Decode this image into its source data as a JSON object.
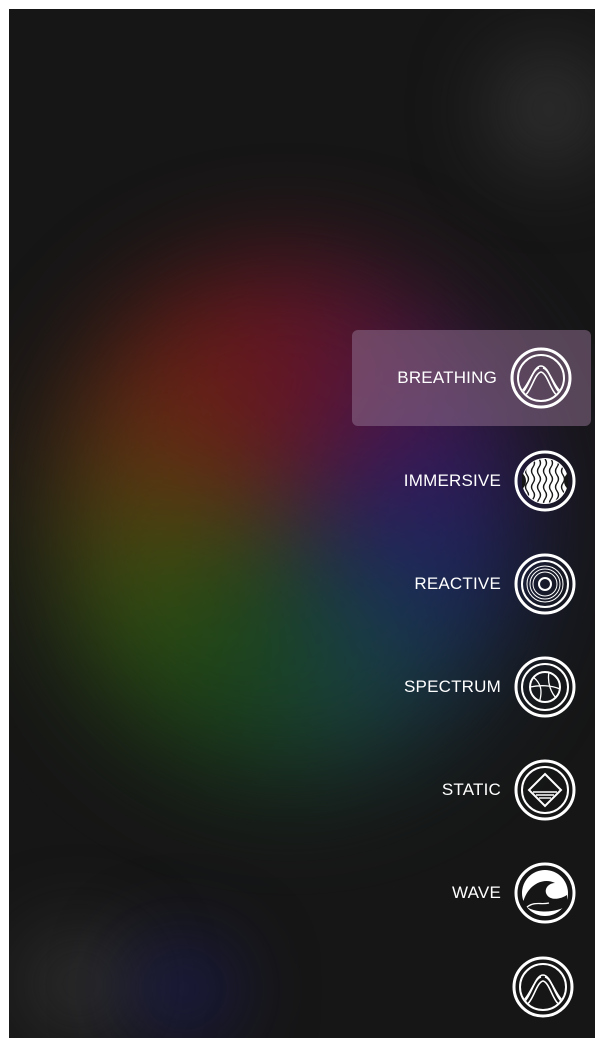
{
  "modes": [
    {
      "id": "breathing",
      "label": "BREATHING",
      "icon": "breathing-icon",
      "active": true
    },
    {
      "id": "immersive",
      "label": "IMMERSIVE",
      "icon": "immersive-icon",
      "active": false
    },
    {
      "id": "reactive",
      "label": "REACTIVE",
      "icon": "reactive-icon",
      "active": false
    },
    {
      "id": "spectrum",
      "label": "SPECTRUM",
      "icon": "spectrum-icon",
      "active": false
    },
    {
      "id": "static",
      "label": "STATIC",
      "icon": "static-icon",
      "active": false
    },
    {
      "id": "wave",
      "label": "WAVE",
      "icon": "wave-icon",
      "active": false
    }
  ],
  "current_mode_button": {
    "icon": "breathing-icon"
  },
  "colors": {
    "background": "#161616",
    "active_highlight": "#8c6e8c",
    "icon_stroke": "#ffffff"
  }
}
